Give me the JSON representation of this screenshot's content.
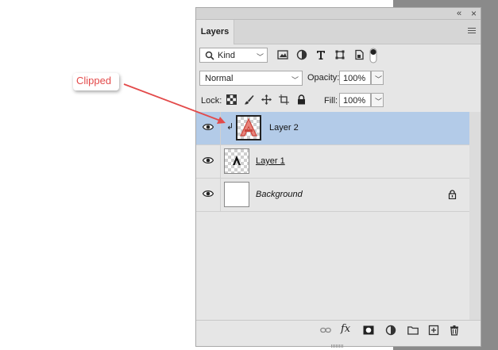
{
  "panel": {
    "collapse_icon": "«",
    "close_icon": "×",
    "tab_label": "Layers",
    "menu_icon": "panel-menu-icon"
  },
  "filter": {
    "kind_label": "Kind",
    "icons": [
      "pixel-filter-icon",
      "adjustment-filter-icon",
      "type-filter-icon",
      "shape-filter-icon",
      "smart-object-filter-icon",
      "filter-toggle-icon"
    ]
  },
  "blend": {
    "mode": "Normal",
    "opacity_label": "Opacity:",
    "opacity_value": "100%"
  },
  "lock": {
    "label": "Lock:",
    "icons": [
      "lock-transparent-icon",
      "lock-image-icon",
      "lock-position-icon",
      "lock-artboard-icon",
      "lock-all-icon"
    ],
    "fill_label": "Fill:",
    "fill_value": "100%"
  },
  "layers": [
    {
      "name": "Layer 2",
      "selected": true,
      "clipped": true
    },
    {
      "name": "Layer 1",
      "selected": false,
      "clipped": false
    },
    {
      "name": "Background",
      "selected": false,
      "clipped": false,
      "locked": true
    }
  ],
  "bottom_icons": [
    "link-layers-icon",
    "fx-icon",
    "mask-icon",
    "adjustment-layer-icon",
    "group-folder-icon",
    "new-layer-icon",
    "delete-icon"
  ],
  "fx_label": "fx",
  "annotation": {
    "text": "Clipped",
    "color": "#e34a4a"
  },
  "colors": {
    "selected_row": "#b3cbe8",
    "panel_bg": "#e6e6e6"
  }
}
